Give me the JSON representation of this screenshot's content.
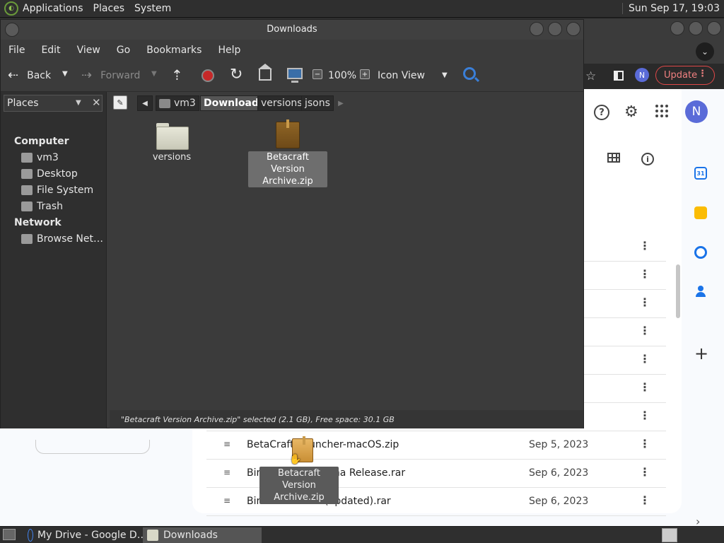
{
  "top_panel": {
    "menus": [
      "Applications",
      "Places",
      "System"
    ],
    "clock": "Sun Sep 17, 19:03"
  },
  "chrome": {
    "update_label": "Update",
    "avatar_initial": "N"
  },
  "drive": {
    "avatar_initial": "N",
    "calendar_day": "31",
    "rows": [
      {
        "name": "BetaCraft-Launcher-macOS.zip",
        "date": "Sep 5, 2023"
      },
      {
        "name": "Birthday      e for Alpha Release.rar",
        "date": "Sep 6, 2023"
      },
      {
        "name": "Bir              eta Release (updated).rar",
        "date": "Sep 6, 2023"
      }
    ]
  },
  "file_manager": {
    "title": "Downloads",
    "menus": [
      "File",
      "Edit",
      "View",
      "Go",
      "Bookmarks",
      "Help"
    ],
    "toolbar": {
      "back": "Back",
      "forward": "Forward",
      "zoom": "100%",
      "view_mode": "Icon View"
    },
    "sidebar": {
      "header": "Places",
      "computer_label": "Computer",
      "computer_items": [
        "vm3",
        "Desktop",
        "File System",
        "Trash"
      ],
      "network_label": "Network",
      "network_items": [
        "Browse Net…"
      ]
    },
    "pathbar": [
      "vm3",
      "Downloads",
      "versions",
      "jsons"
    ],
    "items": [
      {
        "label": "versions",
        "type": "folder"
      },
      {
        "label": "Betacraft Version Archive.zip",
        "type": "archive"
      }
    ],
    "status": "\"Betacraft Version Archive.zip\" selected (2.1 GB), Free space: 30.1 GB"
  },
  "drag": {
    "label": "Betacraft Version Archive.zip"
  },
  "taskbar": {
    "tasks": [
      "My Drive - Google D…",
      "Downloads"
    ]
  }
}
